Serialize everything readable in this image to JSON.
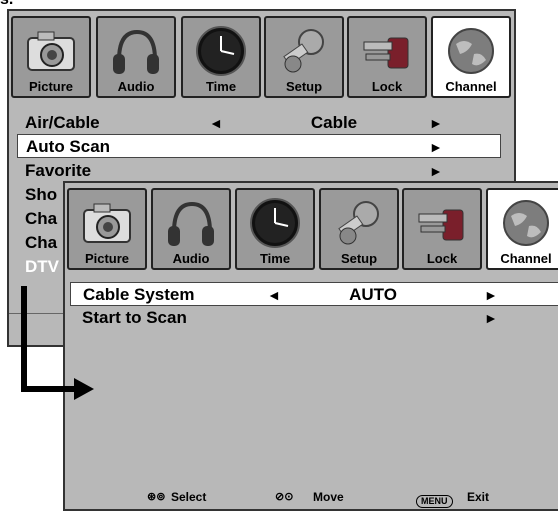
{
  "top_fragment": "s.",
  "tabs": [
    "Picture",
    "Audio",
    "Time",
    "Setup",
    "Lock",
    "Channel"
  ],
  "menu1": {
    "rows": [
      {
        "name": "Air/Cable",
        "value": "Cable",
        "left_arrow": "◄",
        "right_arrow": "►"
      },
      {
        "name": "Auto Scan",
        "right_arrow": "►"
      },
      {
        "name": "Favorite",
        "right_arrow": "►"
      },
      {
        "name": "Sho"
      },
      {
        "name": "Cha"
      },
      {
        "name": "Cha"
      },
      {
        "name": "DTV"
      }
    ]
  },
  "menu2": {
    "rows": [
      {
        "name": "Cable System",
        "value": "AUTO",
        "left_arrow": "◄",
        "right_arrow": "►"
      },
      {
        "name": "Start to Scan",
        "right_arrow": "►"
      }
    ]
  },
  "footer": {
    "select_icon": "⊛⊚",
    "select": "Select",
    "move_icon": "⊘⊙",
    "move": "Move",
    "menu_pill": "MENU",
    "exit": "Exit"
  }
}
